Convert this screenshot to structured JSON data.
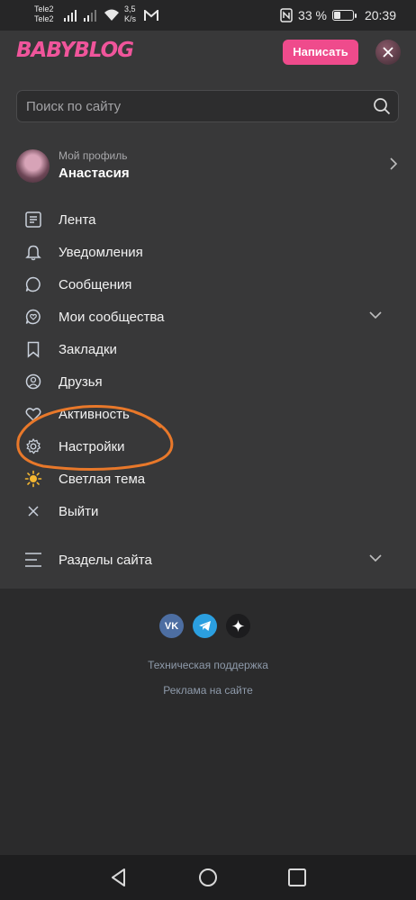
{
  "status_bar": {
    "carrier_1": "Tele2",
    "carrier_2": "Tele2",
    "speed_value": "3,5",
    "speed_unit": "K/s",
    "battery_percent": "33 %",
    "battery_level": 0.33,
    "time": "20:39"
  },
  "header": {
    "logo": "BABYBLOG",
    "write_label": "Написать"
  },
  "search": {
    "placeholder": "Поиск по сайту",
    "value": ""
  },
  "profile": {
    "subtitle": "Мой профиль",
    "name": "Анастасия"
  },
  "menu": {
    "items": [
      {
        "label": "Лента",
        "icon": "feed-icon"
      },
      {
        "label": "Уведомления",
        "icon": "bell-icon"
      },
      {
        "label": "Сообщения",
        "icon": "chat-icon"
      },
      {
        "label": "Мои сообщества",
        "icon": "community-icon",
        "expandable": true
      },
      {
        "label": "Закладки",
        "icon": "bookmark-icon"
      },
      {
        "label": "Друзья",
        "icon": "friends-icon"
      },
      {
        "label": "Активность",
        "icon": "activity-icon"
      },
      {
        "label": "Настройки",
        "icon": "gear-icon"
      },
      {
        "label": "Светлая тема",
        "icon": "sun-icon"
      },
      {
        "label": "Выйти",
        "icon": "close-icon"
      }
    ],
    "sections_label": "Разделы сайта"
  },
  "footer": {
    "vk_label": "VK",
    "support": "Техническая поддержка",
    "ads": "Реклама на сайте"
  },
  "colors": {
    "accent": "#ef4b8c",
    "background": "#2b2b2c",
    "panel": "#383839",
    "annotation": "#e8782a",
    "icon_sun": "#f5b731"
  }
}
